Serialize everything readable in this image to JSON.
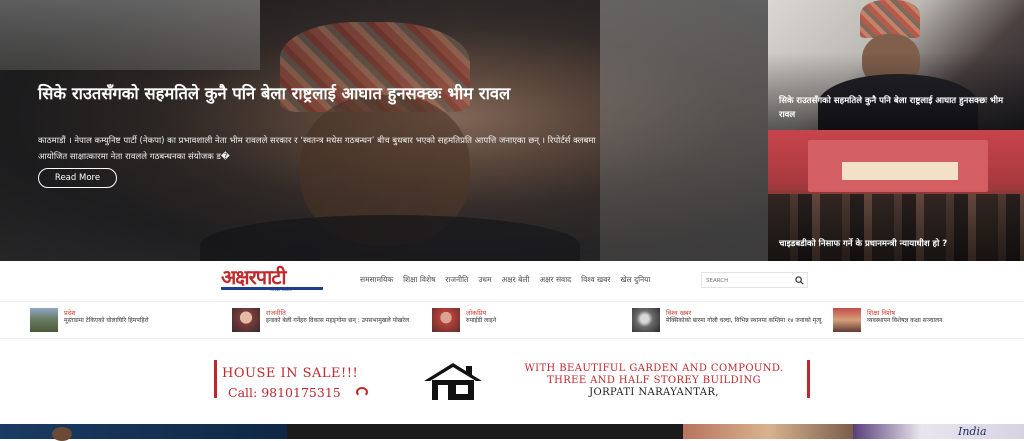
{
  "hero": {
    "title": "सिके राउतसँगको सहमतिले कुनै पनि बेला राष्ट्रलाई आघात हुनसक्छः भीम रावल",
    "description": "काठमाडौं । नेपाल कम्युनिष्ट पार्टी (नेकपा) का प्रभावशाली नेता भीम रावलले सरकार र ‘स्वतन्त्र मधेस गठबन्धन’ बीच बुधबार भएको सहमतिप्रति आपत्ति जनाएका छन् । रिपोर्टर्स क्लबमा आयोजित साक्षात्कारमा नेता रावलले गठबन्धनका संयोजक ड�",
    "read_more": "Read More"
  },
  "side_news": [
    {
      "title": "सिके राउतसँगको सहमतिले कुनै पनि बेला राष्ट्रलाई आघात हुनसक्छः भीम रावल"
    },
    {
      "title": "चाइडबडीको निसाफ गर्ने के प्रधानमन्त्री न्यायाधीश हो ?"
    }
  ],
  "logo": {
    "text": "अक्षरपाटी",
    "tagline": "सत्यको आवाज"
  },
  "menu": [
    "समसामयिक",
    "शिक्षा विशेष",
    "राजनीति",
    "उधम",
    "अक्षर बेली",
    "अक्षर संवाद",
    "विश्व खबर",
    "खेल दुनिया"
  ],
  "search": {
    "placeholder": "SEARCH"
  },
  "ticker": [
    {
      "category": "प्रदेश",
      "text": "मुस्ताङमा टेकिएको घोलाघिरि हिमपहिरो"
    },
    {
      "category": "राजनीति",
      "text": "इन्डको बेली गर्नेहरु विकास महङ्‌गोमा छन् : उपसभामुखले पोखरेल"
    },
    {
      "category": "लोकप्रिय",
      "text": "रुपाईडी लाइने"
    },
    {
      "category": "विश्व खबर",
      "text": "मेक्सिकोको बारमा गोली चल्दा, विभिन्न स्थानमा कम्तिमा १४ जनाको मृत्यु"
    },
    {
      "category": "शिक्षा विशेष",
      "text": "व्यवस्थापन विशेषज्ञ कक्षा सञ्चालन"
    }
  ],
  "ad": {
    "left_line1": "HOUSE IN SALE!!!",
    "left_line2": "Call: 9810175315",
    "right_line1": "WITH BEAUTIFUL GARDEN AND COMPOUND.",
    "right_line2": "THREE AND HALF STOREY BUILDING",
    "right_line3": "JORPATI NARAYANTAR,"
  },
  "bottom_strip": {
    "caption": "India"
  },
  "colors": {
    "accent_red": "#c0272d",
    "logo_blue": "#1d3f8e",
    "category_red": "#d33a2c"
  },
  "icons": {
    "search": "search-icon",
    "house": "house-icon"
  }
}
